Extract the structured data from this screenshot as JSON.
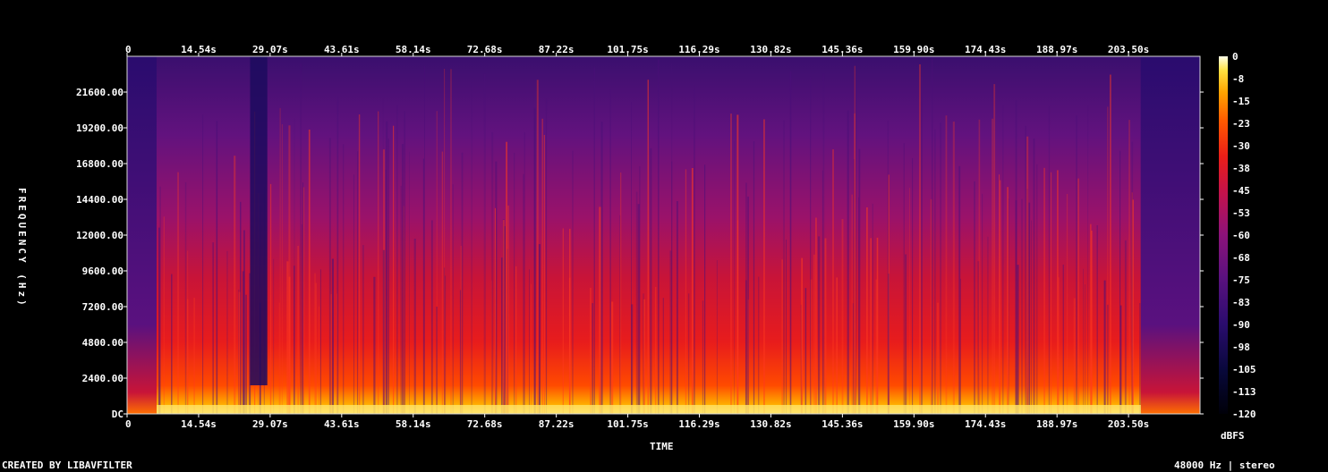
{
  "chart_data": {
    "type": "heatmap",
    "title": "",
    "xlabel": "TIME",
    "ylabel": "FREQUENCY (Hz)",
    "x_ticks": [
      "0",
      "14.54s",
      "29.07s",
      "43.61s",
      "58.14s",
      "72.68s",
      "87.22s",
      "101.75s",
      "116.29s",
      "130.82s",
      "145.36s",
      "159.90s",
      "174.43s",
      "188.97s",
      "203.50s"
    ],
    "x_tick_values": [
      0,
      14.54,
      29.07,
      43.61,
      58.14,
      72.68,
      87.22,
      101.75,
      116.29,
      130.82,
      145.36,
      159.9,
      174.43,
      188.97,
      203.5
    ],
    "xlim": [
      0,
      218.03
    ],
    "y_ticks": [
      "DC",
      "2400.00",
      "4800.00",
      "7200.00",
      "9600.00",
      "12000.00",
      "14400.00",
      "16800.00",
      "19200.00",
      "21600.00"
    ],
    "y_tick_values": [
      0,
      2400,
      4800,
      7200,
      9600,
      12000,
      14400,
      16800,
      19200,
      21600
    ],
    "ylim": [
      0,
      24000
    ],
    "colorbar": {
      "label": "dBFS",
      "ticks": [
        "0",
        "-8",
        "-15",
        "-23",
        "-30",
        "-38",
        "-45",
        "-53",
        "-60",
        "-68",
        "-75",
        "-83",
        "-90",
        "-98",
        "-105",
        "-113",
        "-120"
      ],
      "range": [
        -120,
        0
      ]
    },
    "footer_left": "CREATED BY LIBAVFILTER",
    "footer_right": "48000 Hz | stereo"
  }
}
